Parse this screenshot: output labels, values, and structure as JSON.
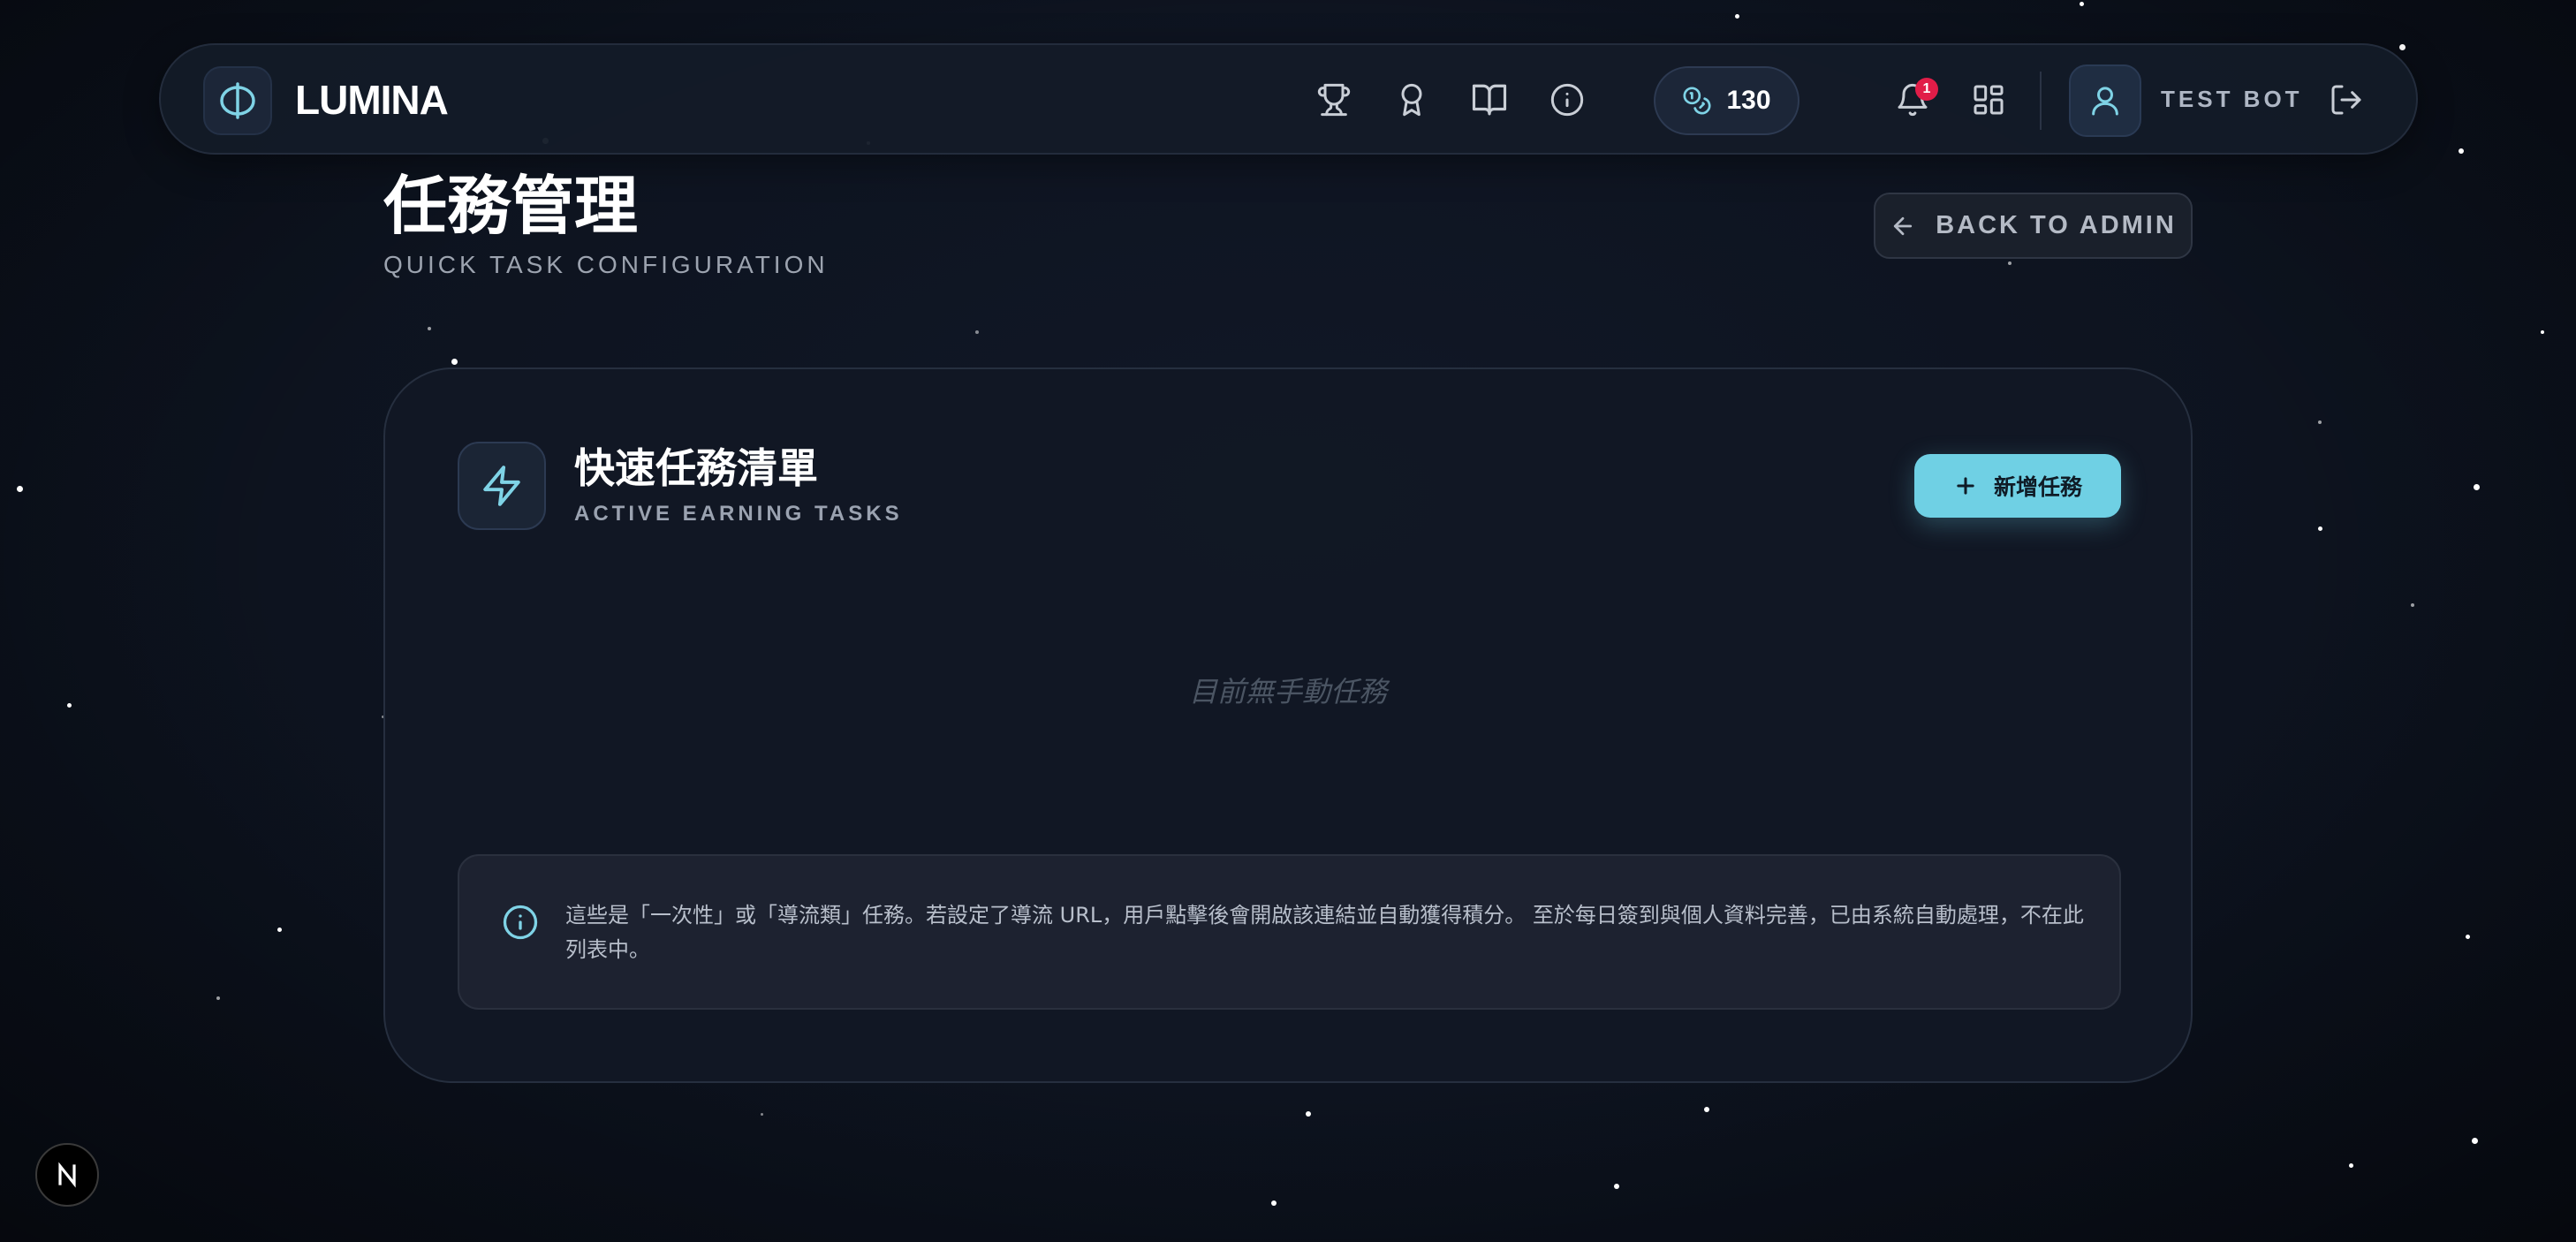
{
  "navbar": {
    "brand": "LUMINA",
    "icons": [
      "trophy-icon",
      "award-icon",
      "book-open-icon",
      "info-icon",
      "bell-icon",
      "grid-icon",
      "user-icon",
      "logout-icon"
    ],
    "points": "130",
    "notification_count": "1",
    "user_name": "TEST BOT"
  },
  "page": {
    "title": "任務管理",
    "subtitle": "QUICK TASK CONFIGURATION",
    "back_button": "BACK TO ADMIN"
  },
  "card": {
    "title": "快速任務清單",
    "subtitle": "ACTIVE EARNING TASKS",
    "add_button": "新增任務",
    "empty_text": "目前無手動任務",
    "info_text": "這些是「一次性」或「導流類」任務。若設定了導流 URL，用戶點擊後會開啟該連結並自動獲得積分。 至於每日簽到與個人資料完善，已由系統自動處理，不在此列表中。"
  },
  "colors": {
    "accent": "#6fd0e4",
    "badge": "#e11d48",
    "background": "#0d131f"
  }
}
